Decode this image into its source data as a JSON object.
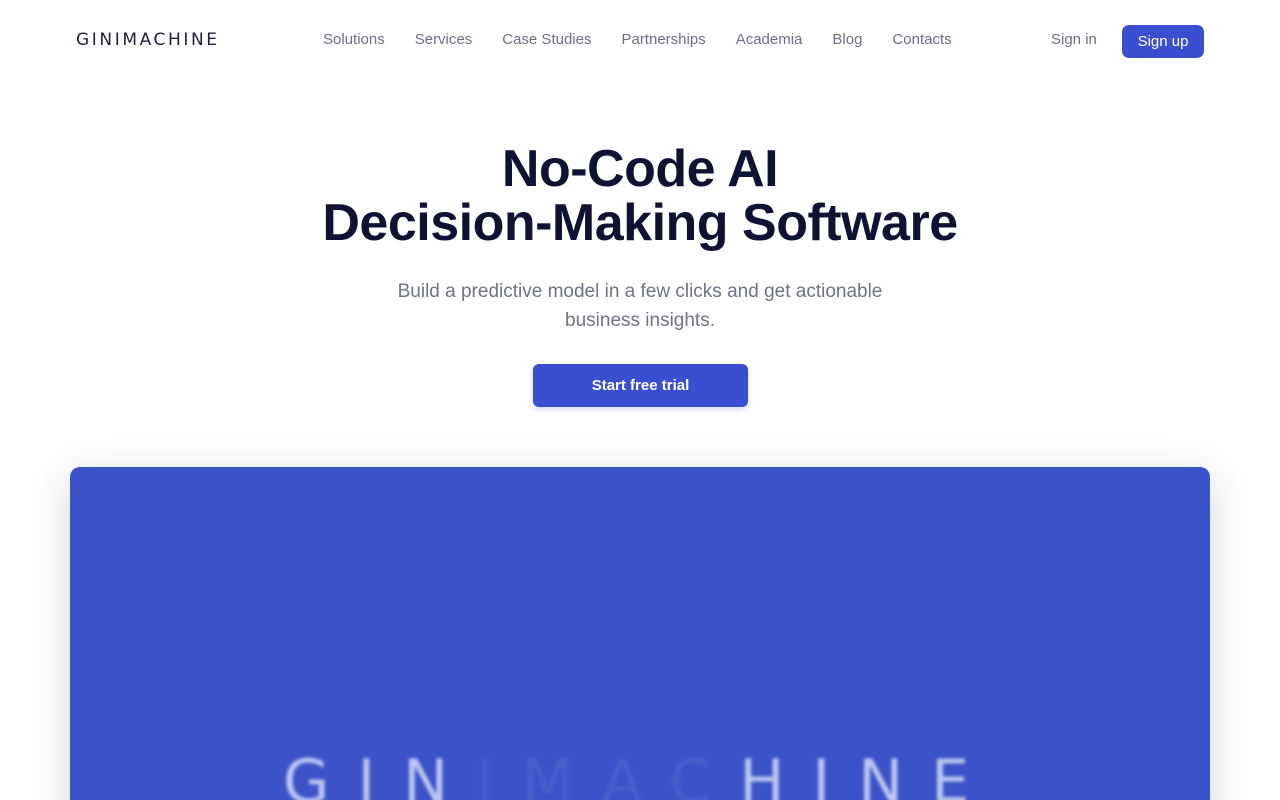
{
  "header": {
    "logo_text": "GINIMACHINE",
    "nav": [
      {
        "label": "Solutions"
      },
      {
        "label": "Services"
      },
      {
        "label": "Case Studies"
      },
      {
        "label": "Partnerships"
      },
      {
        "label": "Academia"
      },
      {
        "label": "Blog"
      },
      {
        "label": "Contacts"
      }
    ],
    "sign_in_label": "Sign in",
    "sign_up_label": "Sign up"
  },
  "hero": {
    "title_line1": "No-Code AI",
    "title_line2": "Decision-Making Software",
    "subtitle": "Build a predictive model in a few clicks and get actionable business insights.",
    "cta_label": "Start free trial"
  },
  "showcase": {
    "logo_left": "GIN",
    "logo_mid": "IMAC",
    "logo_right": "HINE"
  },
  "colors": {
    "accent": "#3a4ed0",
    "showcase_bg": "#3b53c8",
    "title": "#0f1233",
    "muted_text": "#6b7183"
  }
}
